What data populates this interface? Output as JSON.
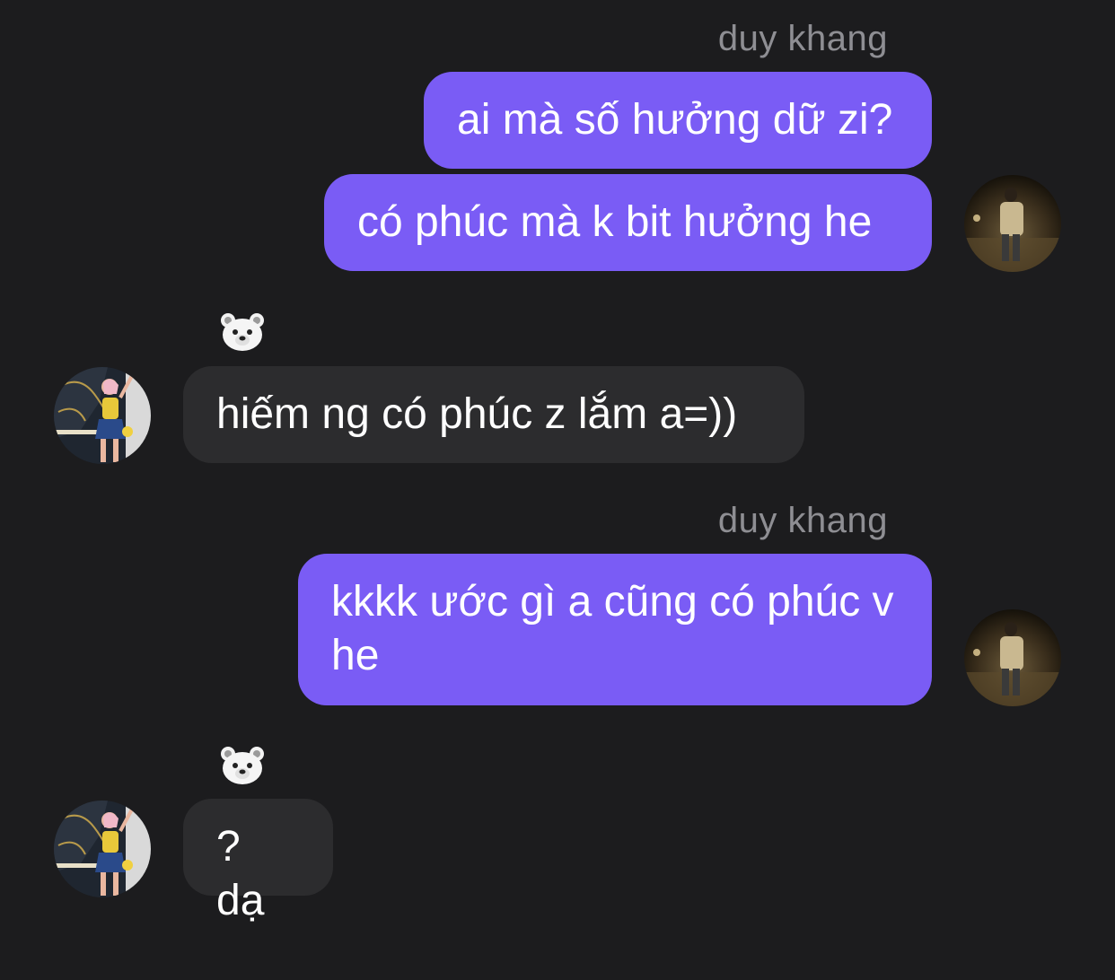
{
  "conversation": {
    "messages": [
      {
        "sender": "duy khang",
        "text": "ai mà số hưởng dữ zi?"
      },
      {
        "sender": "duy khang",
        "text": "có phúc mà k bit hưởng he"
      },
      {
        "sender": "bear",
        "text": "hiếm ng có phúc z lắm a=))"
      },
      {
        "sender": "duy khang",
        "text": "kkkk ước gì a cũng có phúc v he"
      },
      {
        "sender": "bear",
        "text": "? dạ"
      }
    ],
    "names": {
      "outgoing_1": "duy khang",
      "outgoing_2": "duy khang"
    },
    "icons": {
      "incoming_sender": "polar-bear-emoji-icon",
      "outgoing_avatar": "user-avatar-night-photo",
      "incoming_avatar": "user-avatar-dancer-photo"
    }
  },
  "colors": {
    "background": "#1c1c1e",
    "outgoing_bubble": "#7a5cf5",
    "incoming_bubble": "#2c2c2e",
    "sender_name": "#8e8e93"
  }
}
